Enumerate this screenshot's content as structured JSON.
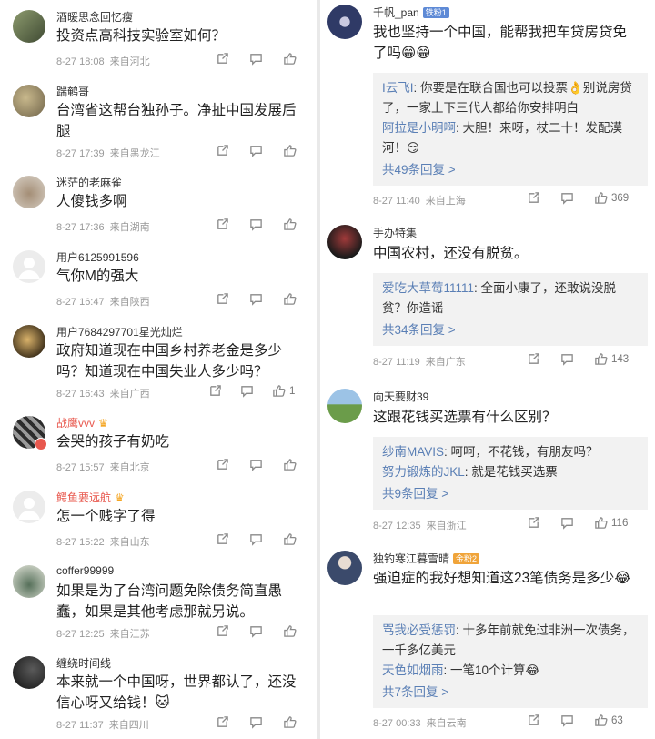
{
  "left": [
    {
      "name": "酒暖思念回忆瘦",
      "text": "投资点高科技实验室如何？",
      "time": "8-27 18:08",
      "loc": "来自河北",
      "likes": "",
      "avatar_color": "#6f7b5a",
      "avatar_icon": "landscape-avatar"
    },
    {
      "name": "踹鹌哥",
      "text": "台湾省这帮台独孙子。净扯中国发展后腿",
      "time": "8-27 17:39",
      "loc": "来自黑龙江",
      "likes": "",
      "avatar_color": "#a89a76",
      "avatar_icon": "photo-avatar"
    },
    {
      "name": "迷茫的老麻雀",
      "text": "人傻钱多啊",
      "time": "8-27 17:36",
      "loc": "来自湖南",
      "likes": "",
      "avatar_color": "#8e8072",
      "avatar_icon": "sparrow-avatar"
    },
    {
      "name": "用户6125991596",
      "text": "气你M的强大",
      "time": "8-27 16:47",
      "loc": "来自陕西",
      "likes": "",
      "avatar_color": "#e6e6e6",
      "avatar_icon": "default-user-avatar"
    },
    {
      "name": "用户7684297701星光灿烂",
      "text": "政府知道现在中国乡村养老金是多少吗？知道现在中国失业人多少吗？",
      "time": "8-27 16:43",
      "loc": "来自广西",
      "likes": "1",
      "avatar_color": "#6b5a3d",
      "avatar_icon": "moon-avatar"
    },
    {
      "name": "战鹰vvv",
      "text": "会哭的孩子有奶吃",
      "time": "8-27 15:57",
      "loc": "来自北京",
      "likes": "",
      "avatar_color": "#53565a",
      "avatar_icon": "zebra-avatar",
      "vip": true
    },
    {
      "name": "鳄鱼要远航",
      "text": "怎一个贱字了得",
      "time": "8-27 15:22",
      "loc": "来自山东",
      "likes": "",
      "avatar_color": "#e6e6e6",
      "avatar_icon": "default-user-avatar",
      "vip": true
    },
    {
      "name": "coffer99999",
      "text": "如果是为了台湾问题免除债务简直愚蠢，如果是其他考虑那就另说。",
      "time": "8-27 12:25",
      "loc": "来自江苏",
      "likes": "",
      "avatar_color": "#5c6e5c",
      "avatar_icon": "horse-avatar"
    },
    {
      "name": "缠绕时间线",
      "text": "本来就一个中国呀，世界都认了，还没信心呀又给钱！🐱",
      "time": "8-27 11:37",
      "loc": "来自四川",
      "likes": "",
      "avatar_color": "#2d2d2d",
      "avatar_icon": "dark-avatar"
    }
  ],
  "right": [
    {
      "name": "千帆_pan",
      "badge": "铁粉1",
      "text": "我也坚持一个中国，能帮我把车贷房贷免了吗😁😁",
      "time": "8-27 11:40",
      "loc": "来自上海",
      "likes": "369",
      "avatar_color": "#2f3a66",
      "avatar_icon": "emblem-avatar",
      "replies": [
        {
          "who": "I云飞I",
          "text": ": 你要是在联合国也可以投票👌别说房贷了，一家上下三代人都给你安排明白"
        },
        {
          "who": "阿拉是小明啊",
          "text": ": 大胆！来呀，杖二十！发配漠河！😏"
        }
      ],
      "more": "共49条回复 >"
    },
    {
      "name": "手办特集",
      "badge": "",
      "text": "中国农村，还没有脱贫。",
      "time": "8-27 11:19",
      "loc": "来自广东",
      "likes": "143",
      "avatar_color": "#3a2a2a",
      "avatar_icon": "figure-avatar",
      "replies": [
        {
          "who": "爱吃大草莓11111",
          "text": ": 全面小康了，还敢说没脱贫？你造谣"
        }
      ],
      "more": "共34条回复 >"
    },
    {
      "name": "向天要财39",
      "badge": "",
      "text": "这跟花钱买选票有什么区别？",
      "time": "8-27 12:35",
      "loc": "来自浙江",
      "likes": "116",
      "avatar_color": "#6b9c4a",
      "avatar_icon": "field-avatar",
      "replies": [
        {
          "who": "纱南MAVIS",
          "text": ": 呵呵，不花钱，有朋友吗？"
        },
        {
          "who": "努力锻炼的JKL",
          "text": ": 就是花钱买选票"
        }
      ],
      "more": "共9条回复 >"
    },
    {
      "name": "独钓寒江暮雪晴",
      "badge": "金粉2",
      "text": "强迫症的我好想知道这23笔债务是多少😂",
      "time": "8-27 00:33",
      "loc": "来自云南",
      "likes": "63",
      "avatar_color": "#3b4a6b",
      "avatar_icon": "anime-avatar",
      "replies": [
        {
          "who": "骂我必受惩罚",
          "text": ": 十多年前就免过非洲一次债务，一千多亿美元"
        },
        {
          "who": "天色如烟雨",
          "text": ": 一笔10个计算😂"
        }
      ],
      "more": "共7条回复 >"
    }
  ],
  "colors": {
    "reply_name": "#5a7fb5",
    "vip_name": "#e8584e",
    "iron_badge": "#5e8ad6",
    "gold_badge": "#f0a43a"
  }
}
